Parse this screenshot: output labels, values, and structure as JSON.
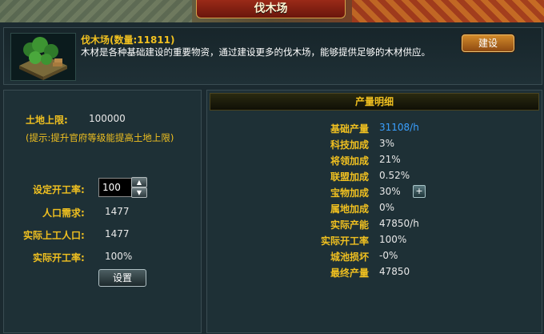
{
  "window": {
    "title": "伐木场"
  },
  "header": {
    "name_qty": "伐木场(数量:11811)",
    "description": "木材是各种基础建设的重要物资，通过建设更多的伐木场，能够提供足够的木材供应。",
    "build_button": "建设"
  },
  "left": {
    "land_limit_label": "土地上限:",
    "land_limit_value": "100000",
    "hint": "(提示:提升官府等级能提高土地上限)",
    "work_rate_label": "设定开工率:",
    "work_rate_value": "100",
    "population_need_label": "人口需求:",
    "population_need_value": "1477",
    "actual_workers_label": "实际上工人口:",
    "actual_workers_value": "1477",
    "actual_rate_label": "实际开工率:",
    "actual_rate_value": "100%",
    "set_button": "设置"
  },
  "right": {
    "heading": "产量明细",
    "rows": [
      {
        "label": "基础产量",
        "value": "31108/h",
        "color": "#3aa0ff"
      },
      {
        "label": "科技加成",
        "value": "3%"
      },
      {
        "label": "将领加成",
        "value": "21%"
      },
      {
        "label": "联盟加成",
        "value": "0.52%"
      },
      {
        "label": "宝物加成",
        "value": "30%"
      },
      {
        "label": "属地加成",
        "value": "0%"
      },
      {
        "label": "实际产能",
        "value": "47850/h"
      },
      {
        "label": "实际开工率",
        "value": "100%"
      },
      {
        "label": "城池损坏",
        "value": "-0%"
      },
      {
        "label": "最终产量",
        "value": "47850"
      }
    ]
  },
  "icons": {
    "building": "lumber-mill-icon",
    "plus": "plus-icon",
    "up": "arrow-up-icon",
    "down": "arrow-down-icon"
  }
}
